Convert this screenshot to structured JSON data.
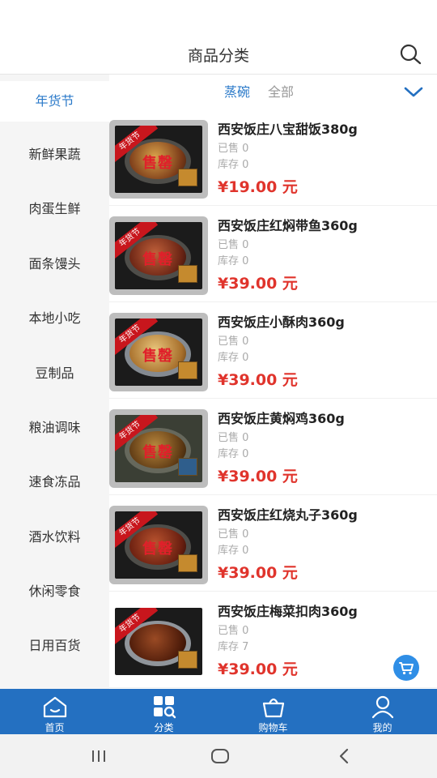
{
  "header": {
    "title": "商品分类",
    "search_icon": "search-icon"
  },
  "sidebar": {
    "items": [
      {
        "label": "年货节",
        "active": true
      },
      {
        "label": "新鲜果蔬"
      },
      {
        "label": "肉蛋生鲜"
      },
      {
        "label": "面条馒头"
      },
      {
        "label": "本地小吃"
      },
      {
        "label": "豆制品"
      },
      {
        "label": "粮油调味"
      },
      {
        "label": "速食冻品"
      },
      {
        "label": "酒水饮料"
      },
      {
        "label": "休闲零食"
      },
      {
        "label": "日用百货"
      }
    ]
  },
  "subtabs": [
    {
      "label": "蒸碗",
      "active": true
    },
    {
      "label": "全部"
    }
  ],
  "products": [
    {
      "name": "西安饭庄八宝甜饭380g",
      "sold": "已售 0",
      "stock": "库存 0",
      "price": "¥19.00 元",
      "ribbon": "年货节",
      "overlay": "售罄"
    },
    {
      "name": "西安饭庄红焖带鱼360g",
      "sold": "已售 0",
      "stock": "库存 0",
      "price": "¥39.00 元",
      "ribbon": "年货节",
      "overlay": "售罄"
    },
    {
      "name": "西安饭庄小酥肉360g",
      "sold": "已售 0",
      "stock": "库存 0",
      "price": "¥39.00 元",
      "ribbon": "年货节",
      "overlay": "售罄"
    },
    {
      "name": "西安饭庄黄焖鸡360g",
      "sold": "已售 0",
      "stock": "库存 0",
      "price": "¥39.00 元",
      "ribbon": "年货节",
      "overlay": "售罄"
    },
    {
      "name": "西安饭庄红烧丸子360g",
      "sold": "已售 0",
      "stock": "库存 0",
      "price": "¥39.00 元",
      "ribbon": "年货节",
      "overlay": "售罄"
    },
    {
      "name": "西安饭庄梅菜扣肉360g",
      "sold": "已售 0",
      "stock": "库存 7",
      "price": "¥39.00 元",
      "ribbon": "年货节",
      "overlay": ""
    }
  ],
  "tabbar": [
    {
      "label": "首页",
      "icon": "home-icon"
    },
    {
      "label": "分类",
      "icon": "category-icon"
    },
    {
      "label": "购物车",
      "icon": "shopping-bag-icon"
    },
    {
      "label": "我的",
      "icon": "user-icon"
    }
  ],
  "colors": {
    "accent": "#2b7ac9",
    "tabbar": "#2470c1",
    "price": "#e0342c",
    "soldout": "#e0202a",
    "ribbon": "#c8161d"
  }
}
